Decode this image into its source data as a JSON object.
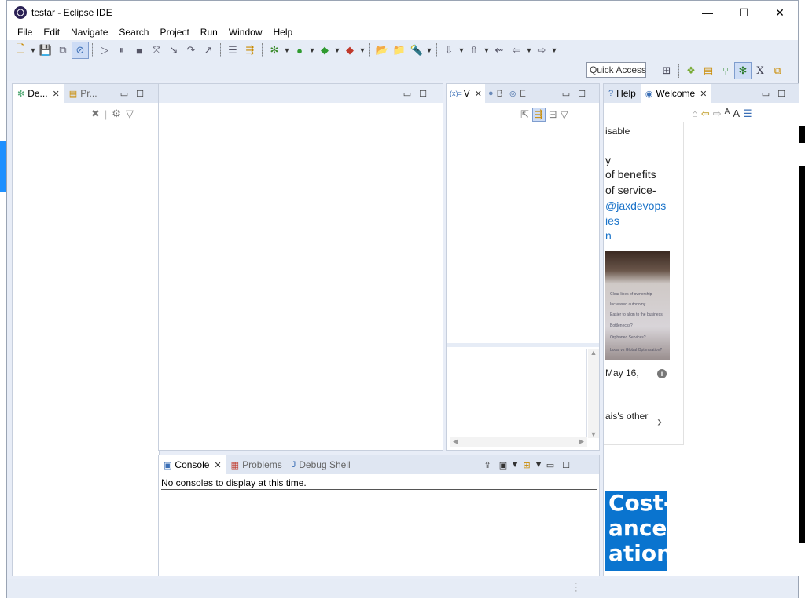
{
  "window": {
    "title": "testar - Eclipse IDE"
  },
  "window_controls": {
    "minimize": "—",
    "maximize": "☐",
    "close": "✕"
  },
  "menu": [
    "File",
    "Edit",
    "Navigate",
    "Search",
    "Project",
    "Run",
    "Window",
    "Help"
  ],
  "quick_access": {
    "placeholder": "Quick Access"
  },
  "debug_view": {
    "tabs": [
      {
        "label": "De...",
        "active": true
      },
      {
        "label": "Pr...",
        "active": false
      }
    ]
  },
  "variables_view": {
    "tabs": [
      {
        "label": "V",
        "prefix": "(x)=",
        "active": true
      },
      {
        "label": "B",
        "active": false
      },
      {
        "label": "E",
        "active": false
      }
    ]
  },
  "console_view": {
    "tabs": [
      {
        "label": "Console",
        "active": true
      },
      {
        "label": "Problems",
        "active": false
      },
      {
        "label": "Debug Shell",
        "active": false
      }
    ],
    "message": "No consoles to display at this time."
  },
  "help_view": {
    "tabs": [
      {
        "label": "Help",
        "active": false
      },
      {
        "label": "Welcome",
        "active": true
      }
    ]
  },
  "welcome_content": {
    "line1": "isable",
    "line2": "y",
    "line3": "of benefits",
    "line4": "of service-",
    "link1": "@jaxdevops",
    "link2": "ies",
    "link3": "n",
    "photo_lines": [
      "Clear lines of ownership",
      "Increased autonomy",
      "Easier to align to the business",
      "Bottlenecks?",
      "Orphaned Services?",
      "Local vs Global Optimisation?"
    ],
    "date": "May 16,",
    "more_link": "ais's other",
    "banner_lines": [
      "Cost-",
      "ance",
      "ations",
      "..."
    ]
  },
  "colors": {
    "accent": "#0a74cf",
    "chrome": "#e6ecf6",
    "link": "#1a73c9"
  }
}
